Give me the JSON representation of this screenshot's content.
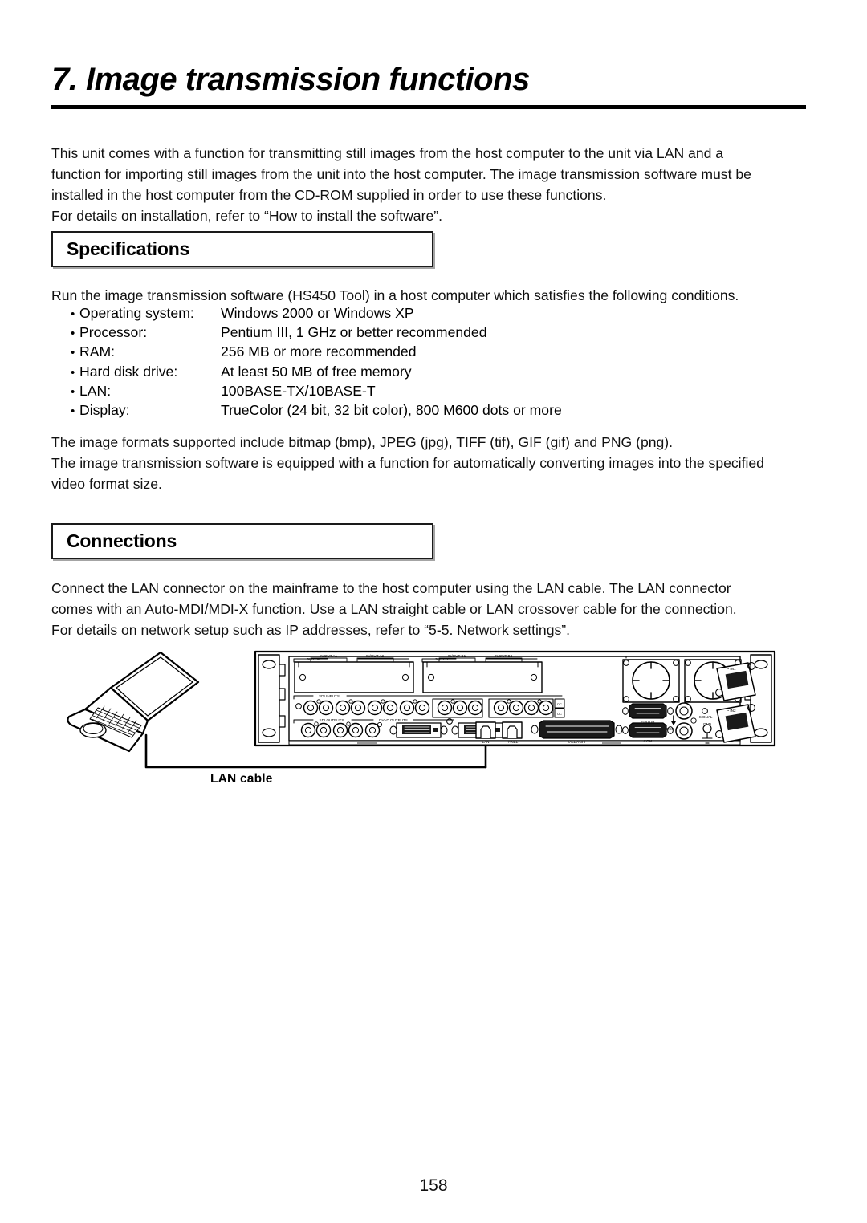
{
  "chapter": {
    "title": "7. Image transmission functions"
  },
  "intro": {
    "line1": "This unit comes with a function for transmitting still images from the host computer to the unit via LAN and a",
    "line2": "function for importing still images from the unit into the host computer. The image transmission software must be",
    "line3": "installed in the host computer from the CD-ROM supplied in order to use these functions.",
    "line4": "For details on installation, refer to “How to install the software”."
  },
  "specifications": {
    "heading": "Specifications",
    "intro": "Run the image transmission software (HS450 Tool) in a host computer which satisfies the following conditions.",
    "bullet": "•",
    "items": [
      {
        "label": "Operating system:",
        "value": "Windows 2000 or Windows XP"
      },
      {
        "label": "Processor:",
        "value": "Pentium III, 1 GHz or better recommended"
      },
      {
        "label": "RAM:",
        "value": "256 MB or more recommended"
      },
      {
        "label": "Hard disk drive:",
        "value": "At least 50 MB of free memory"
      },
      {
        "label": "LAN:",
        "value": "100BASE-TX/10BASE-T"
      },
      {
        "label": "Display:",
        "value": "TrueColor (24 bit, 32 bit color), 800  M600 dots or more"
      }
    ],
    "formats_line1": "The image formats supported include bitmap (bmp), JPEG (jpg), TIFF (tif), GIF (gif) and PNG (png).",
    "formats_line2": "The image transmission software is equipped with a function for automatically converting images into the specified",
    "formats_line3": "video format size."
  },
  "connections": {
    "heading": "Connections",
    "line1": "Connect the LAN connector on the mainframe to the host computer using the LAN cable. The LAN connector",
    "line2": "comes with an Auto-MDI/MDI-X function. Use a LAN straight cable or LAN crossover cable for the connection.",
    "line3": "For details on network setup such as IP addresses, refer to “5-5. Network settings”.",
    "cable_label": "LAN cable",
    "panel_labels": {
      "slot_a": "SLOT A",
      "slot_b": "SLOT B",
      "in_out_a1": "IN/OUT A1",
      "in_out_a2": "IN/OUT A2",
      "in_out_b1": "IN/OUT B1",
      "in_out_b2": "IN/OUT B2",
      "sdi_inputs": "SDI INPUTS",
      "sdi_outputs": "SDI OUTPUTS",
      "dvi_d_outputs": "DVI-D OUTPUTS",
      "lan": "LAN",
      "panel": "PANEL",
      "tally_gpi": "TALLY/GPI",
      "editor": "EDITOR",
      "com": "COM",
      "ref": "REF",
      "signal": "SIGNAL",
      "gnd": "GND",
      "power_in1": "~ IN1",
      "power_in2": "~ IN2",
      "dc": "DC",
      "uc": "UC"
    }
  },
  "footer": {
    "page_number": "158"
  },
  "colors": {
    "text": "#111111",
    "rule": "#000000",
    "box_border": "#1a1a1a"
  }
}
